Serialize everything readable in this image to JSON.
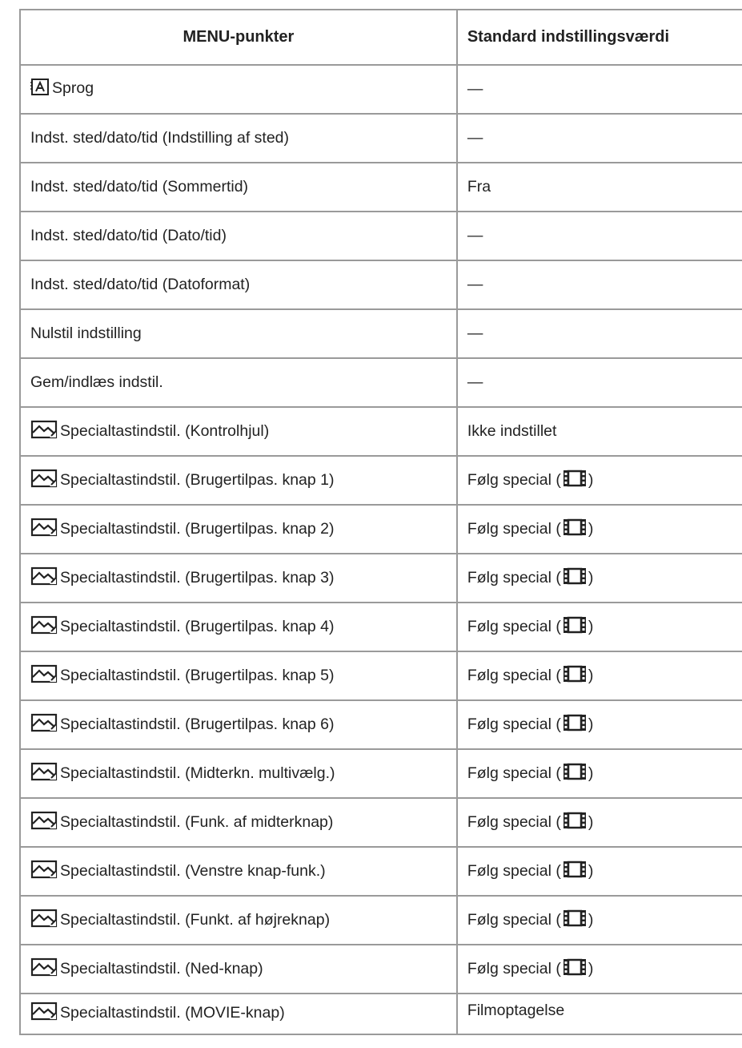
{
  "table": {
    "headers": {
      "item": "MENU-punkter",
      "default": "Standard indstillingsværdi"
    },
    "rows": [
      {
        "icon": "language-icon",
        "item": "Sprog",
        "default": "—"
      },
      {
        "icon": "",
        "item": "Indst. sted/dato/tid (Indstilling af sted)",
        "default": "—"
      },
      {
        "icon": "",
        "item": "Indst. sted/dato/tid (Sommertid)",
        "default": "Fra"
      },
      {
        "icon": "",
        "item": "Indst. sted/dato/tid (Dato/tid)",
        "default": "—"
      },
      {
        "icon": "",
        "item": "Indst. sted/dato/tid (Datoformat)",
        "default": "—"
      },
      {
        "icon": "",
        "item": "Nulstil indstilling",
        "default": "—"
      },
      {
        "icon": "",
        "item": "Gem/indlæs indstil.",
        "default": "—"
      },
      {
        "icon": "custom-image-icon",
        "item": "Specialtastindstil. (Kontrolhjul)",
        "default": "Ikke indstillet"
      },
      {
        "icon": "custom-image-icon",
        "item": "Specialtastindstil. (Brugertilpas. knap 1)",
        "default_prefix": "Følg special (",
        "default_icon": "movie-film-icon",
        "default_suffix": ")"
      },
      {
        "icon": "custom-image-icon",
        "item": "Specialtastindstil. (Brugertilpas. knap 2)",
        "default_prefix": "Følg special (",
        "default_icon": "movie-film-icon",
        "default_suffix": ")"
      },
      {
        "icon": "custom-image-icon",
        "item": "Specialtastindstil. (Brugertilpas. knap 3)",
        "default_prefix": "Følg special (",
        "default_icon": "movie-film-icon",
        "default_suffix": ")"
      },
      {
        "icon": "custom-image-icon",
        "item": "Specialtastindstil. (Brugertilpas. knap 4)",
        "default_prefix": "Følg special (",
        "default_icon": "movie-film-icon",
        "default_suffix": ")"
      },
      {
        "icon": "custom-image-icon",
        "item": "Specialtastindstil. (Brugertilpas. knap 5)",
        "default_prefix": "Følg special (",
        "default_icon": "movie-film-icon",
        "default_suffix": ")"
      },
      {
        "icon": "custom-image-icon",
        "item": "Specialtastindstil. (Brugertilpas. knap 6)",
        "default_prefix": "Følg special (",
        "default_icon": "movie-film-icon",
        "default_suffix": ")"
      },
      {
        "icon": "custom-image-icon",
        "item": "Specialtastindstil. (Midterkn. multivælg.)",
        "default_prefix": "Følg special (",
        "default_icon": "movie-film-icon",
        "default_suffix": ")"
      },
      {
        "icon": "custom-image-icon",
        "item": "Specialtastindstil. (Funk. af midterknap)",
        "default_prefix": "Følg special (",
        "default_icon": "movie-film-icon",
        "default_suffix": ")"
      },
      {
        "icon": "custom-image-icon",
        "item": "Specialtastindstil. (Venstre knap-funk.)",
        "default_prefix": "Følg special (",
        "default_icon": "movie-film-icon",
        "default_suffix": ")"
      },
      {
        "icon": "custom-image-icon",
        "item": "Specialtastindstil. (Funkt. af højreknap)",
        "default_prefix": "Følg special (",
        "default_icon": "movie-film-icon",
        "default_suffix": ")"
      },
      {
        "icon": "custom-image-icon",
        "item": "Specialtastindstil. (Ned-knap)",
        "default_prefix": "Følg special (",
        "default_icon": "movie-film-icon",
        "default_suffix": ")"
      },
      {
        "icon": "custom-image-icon",
        "item": "Specialtastindstil. (MOVIE-knap)",
        "default": "Filmoptagelse"
      }
    ]
  },
  "colors": {
    "border": "#9a9a9a",
    "text": "#222222",
    "background": "#ffffff"
  }
}
